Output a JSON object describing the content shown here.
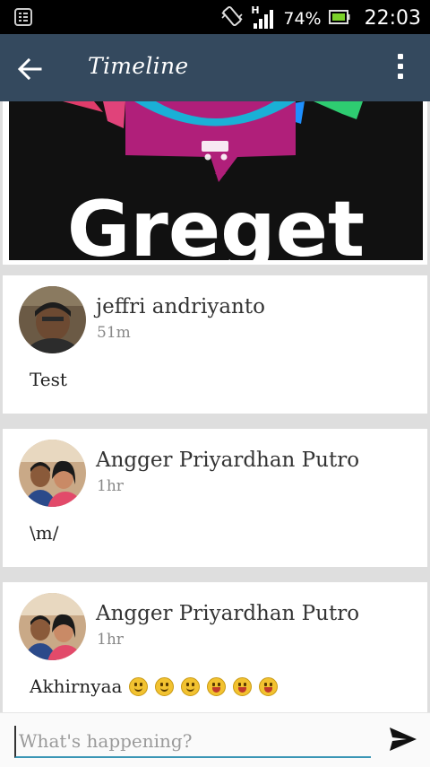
{
  "status_bar": {
    "battery_percent": "74%",
    "time": "22:03",
    "network_label": "H"
  },
  "app_bar": {
    "title": "Timeline"
  },
  "banner": {
    "text": "Greget"
  },
  "posts": [
    {
      "author": "jeffri andriyanto",
      "time": "51m",
      "body": "Test"
    },
    {
      "author": "Angger Priyardhan Putro",
      "time": "1hr",
      "body": "\\m/"
    },
    {
      "author": "Angger Priyardhan Putro",
      "time": "1hr",
      "body": "Akhirnyaa",
      "emojis": [
        "smile",
        "smile",
        "smile",
        "grin",
        "grin",
        "grin"
      ]
    }
  ],
  "composer": {
    "placeholder": "What's happening?"
  },
  "colors": {
    "app_bar": "#34495e",
    "accent": "#3a96b5"
  }
}
